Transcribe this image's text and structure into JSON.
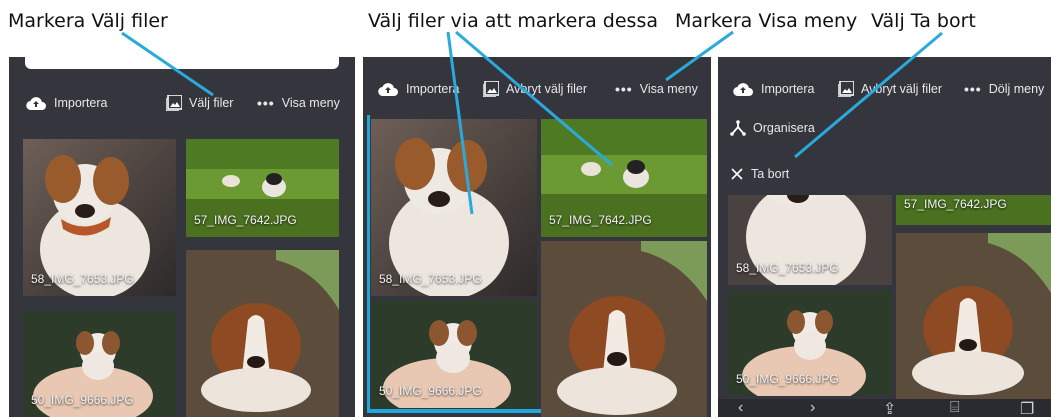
{
  "captions": {
    "c1": "Markera Välj filer",
    "c2": "Välj filer via att markera dessa",
    "c3": "Markera Visa meny",
    "c4": "Välj Ta bort"
  },
  "toolbar": {
    "import": "Importera",
    "select_files": "Välj filer",
    "cancel_select": "Avbryt välj filer",
    "show_menu": "Visa meny",
    "hide_menu": "Dölj meny"
  },
  "menu": {
    "organize": "Organisera",
    "delete": "Ta bort"
  },
  "files": {
    "f1": "58_IMG_7653.JPG",
    "f2": "57_IMG_7642.JPG",
    "f3": "50_IMG_9666.JPG"
  },
  "colors": {
    "panel_bg": "#34353d",
    "selection": "#1ea9d8",
    "annotation_line": "#2aa9dd"
  },
  "icons": [
    "cloud-upload-icon",
    "image-icon",
    "more-dots-icon",
    "organize-icon",
    "close-icon",
    "back-icon",
    "share-icon",
    "book-icon",
    "tabs-icon"
  ]
}
